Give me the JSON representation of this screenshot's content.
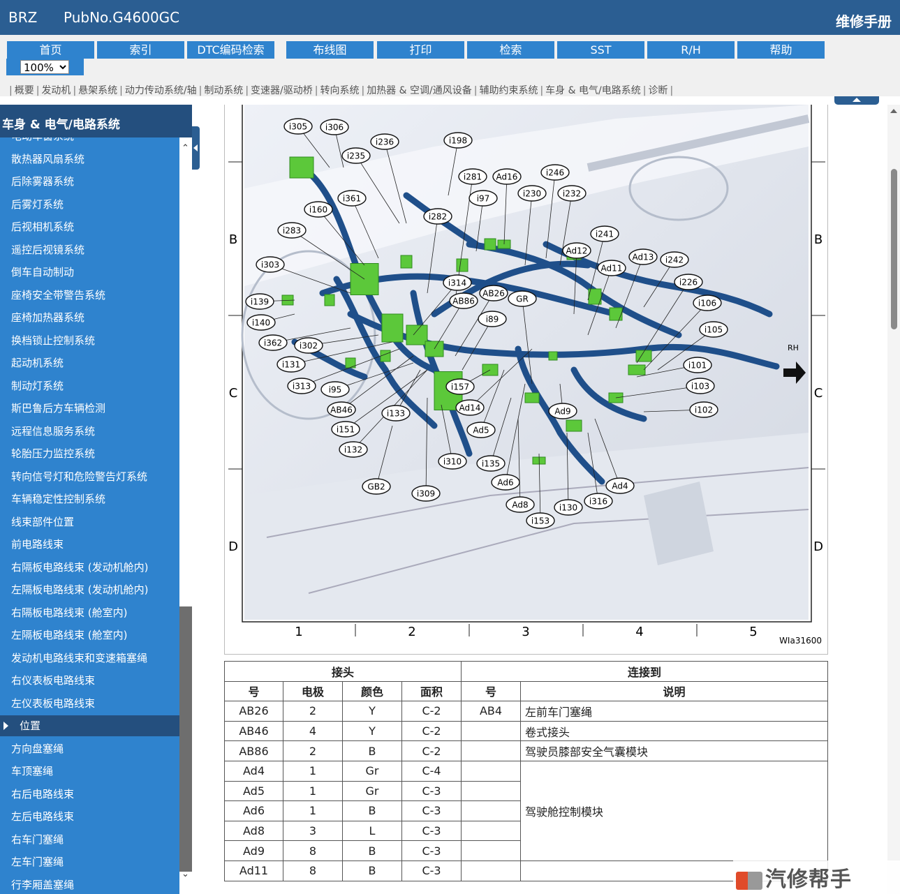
{
  "header": {
    "model": "BRZ",
    "pub_no": "PubNo.G4600GC",
    "manual_title": "维修手册"
  },
  "nav": {
    "buttons": [
      "首页",
      "索引",
      "DTC编码检索",
      "布线图",
      "打印",
      "检索",
      "SST",
      "R/H",
      "帮助"
    ],
    "zoom": "100%"
  },
  "categories": [
    "概要",
    "发动机",
    "悬架系统",
    "动力传动系统/轴",
    "制动系统",
    "变速器/驱动桥",
    "转向系统",
    "加热器 & 空调/通风设备",
    "辅助约束系统",
    "车身 & 电气/电路系统",
    "诊断"
  ],
  "sidebar": {
    "title": "车身 & 电气/电路系统",
    "items": [
      "电动车窗系统",
      "散热器风扇系统",
      "后除雾器系统",
      "后雾灯系统",
      "后视相机系统",
      "遥控后视镜系统",
      "倒车自动制动",
      "座椅安全带警告系统",
      "座椅加热器系统",
      "换档锁止控制系统",
      "起动机系统",
      "制动灯系统",
      "斯巴鲁后方车辆检测",
      "远程信息服务系统",
      "轮胎压力监控系统",
      "转向信号灯和危险警告灯系统",
      "车辆稳定性控制系统",
      "线束部件位置",
      "前电路线束",
      "右隔板电路线束 (发动机舱内)",
      "左隔板电路线束 (发动机舱内)",
      "右隔板电路线束 (舱室内)",
      "左隔板电路线束 (舱室内)",
      "发动机电路线束和变速箱塞绳",
      "右仪表板电路线束",
      "左仪表板电路线束",
      "位置",
      "方向盘塞绳",
      "车顶塞绳",
      "右后电路线束",
      "左后电路线束",
      "右车门塞绳",
      "左车门塞绳",
      "行李厢盖塞绳"
    ],
    "active_index": 26
  },
  "figure": {
    "id": "WIa31600",
    "rh_label": "RH",
    "row_labels": [
      "B",
      "C",
      "D"
    ],
    "col_labels": [
      "1",
      "2",
      "3",
      "4",
      "5"
    ],
    "callouts": [
      "i305",
      "i306",
      "i236",
      "i198",
      "i235",
      "i281",
      "Ad16",
      "i246",
      "i361",
      "i97",
      "i230",
      "i232",
      "i160",
      "i282",
      "i241",
      "i283",
      "Ad12",
      "i303",
      "Ad11",
      "Ad13",
      "i242",
      "i314",
      "i226",
      "AB26",
      "i139",
      "AB86",
      "GR",
      "i106",
      "i140",
      "i89",
      "i105",
      "i362",
      "i302",
      "i131",
      "i101",
      "i313",
      "i95",
      "i157",
      "i103",
      "AB46",
      "Ad14",
      "Ad9",
      "i102",
      "i133",
      "i151",
      "Ad5",
      "i132",
      "i310",
      "i135",
      "GB2",
      "Ad6",
      "Ad4",
      "i309",
      "i316",
      "Ad8",
      "i130",
      "i153"
    ]
  },
  "table": {
    "group_headers": [
      "接头",
      "连接到"
    ],
    "columns": [
      "号",
      "电极",
      "颜色",
      "面积",
      "号",
      "说明"
    ],
    "rows": [
      [
        "AB26",
        "2",
        "Y",
        "C-2",
        "AB4",
        "左前车门塞绳"
      ],
      [
        "AB46",
        "4",
        "Y",
        "C-2",
        "",
        "卷式接头"
      ],
      [
        "AB86",
        "2",
        "B",
        "C-2",
        "",
        "驾驶员膝部安全气囊模块"
      ],
      [
        "Ad4",
        "1",
        "Gr",
        "C-4",
        "",
        ""
      ],
      [
        "Ad5",
        "1",
        "Gr",
        "C-3",
        "",
        ""
      ],
      [
        "Ad6",
        "1",
        "B",
        "C-3",
        "",
        "驾驶舱控制模块"
      ],
      [
        "Ad8",
        "3",
        "L",
        "C-3",
        "",
        ""
      ],
      [
        "Ad9",
        "8",
        "B",
        "C-3",
        "",
        ""
      ],
      [
        "Ad11",
        "8",
        "B",
        "C-3",
        "",
        ""
      ]
    ]
  },
  "watermark": "汽修帮手",
  "colors": {
    "header_bg": "#2b5e92",
    "nav_btn": "#2f83ce",
    "sidebar_bg": "#2f83ce",
    "sidebar_active": "#244f7e",
    "harness": "#1f4f8a",
    "connector": "#5cc83a"
  }
}
